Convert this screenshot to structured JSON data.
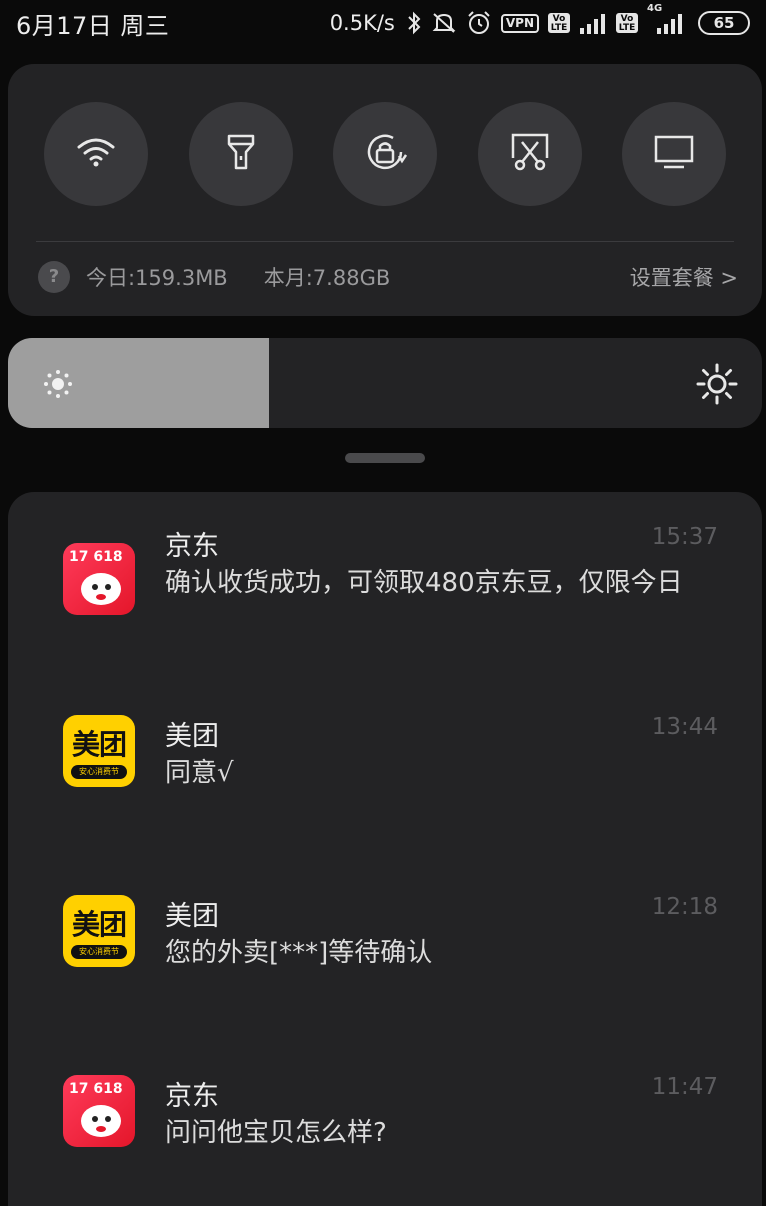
{
  "status_bar": {
    "date": "6月17日 周三",
    "net_speed": "0.5K/s",
    "vpn_label": "VPN",
    "volte_label": "Vo LTE",
    "network_type": "4G",
    "battery": "65",
    "icons": [
      "bluetooth-icon",
      "mute-icon",
      "alarm-icon",
      "vpn-icon",
      "volte-icon",
      "signal-icon",
      "volte-icon",
      "signal-4g-icon",
      "battery-icon"
    ]
  },
  "quick_settings": {
    "toggles": [
      {
        "icon": "wifi-icon"
      },
      {
        "icon": "flashlight-icon"
      },
      {
        "icon": "rotation-lock-icon"
      },
      {
        "icon": "screenshot-icon"
      },
      {
        "icon": "cast-screen-icon"
      }
    ],
    "data_usage": {
      "help_glyph": "?",
      "today": "今日:159.3MB",
      "month": "本月:7.88GB",
      "plan_link": "设置套餐 >"
    }
  },
  "brightness": {
    "level": 0.346,
    "low_icon": "brightness-low-icon",
    "high_icon": "brightness-high-icon"
  },
  "notifications": [
    {
      "app": "京东",
      "icon": "jd-app-icon",
      "icon_text": "17 618",
      "time": "15:37",
      "body": " 确认收货成功，可领取480京东豆，仅限今日"
    },
    {
      "app": "美团",
      "icon": "meituan-app-icon",
      "icon_text": "美团",
      "icon_sub": "安心消费节",
      "time": "13:44",
      "body": "同意√"
    },
    {
      "app": "美团",
      "icon": "meituan-app-icon",
      "icon_text": "美团",
      "icon_sub": "安心消费节",
      "time": "12:18",
      "body": "您的外卖[***]等待确认"
    },
    {
      "app": "京东",
      "icon": "jd-app-icon",
      "icon_text": "17 618",
      "time": "11:47",
      "body": "问问他宝贝怎么样?"
    }
  ],
  "colors": {
    "background": "#0a0a0a",
    "card": "#232325",
    "toggle": "#38383b",
    "brightness_fill": "#9e9e9e",
    "jd_red": "#e4162a",
    "meituan_yellow": "#ffd000"
  }
}
